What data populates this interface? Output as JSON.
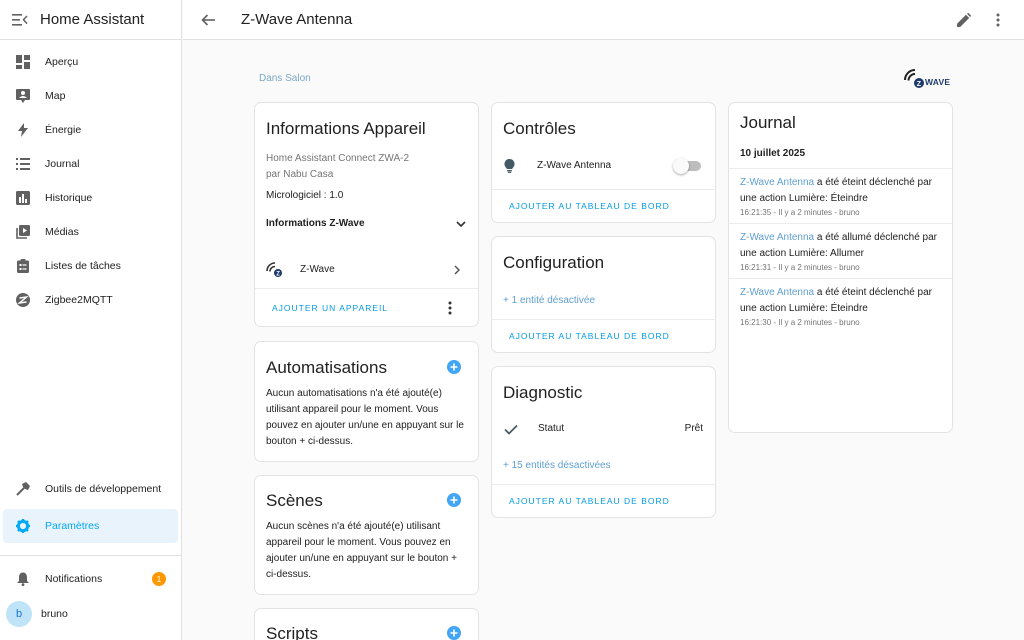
{
  "sidebar": {
    "title": "Home Assistant",
    "items": [
      {
        "label": "Aperçu",
        "icon": "dashboard-icon"
      },
      {
        "label": "Map",
        "icon": "map-icon"
      },
      {
        "label": "Énergie",
        "icon": "lightning-icon"
      },
      {
        "label": "Journal",
        "icon": "list-icon"
      },
      {
        "label": "Historique",
        "icon": "chart-bar-icon"
      },
      {
        "label": "Médias",
        "icon": "play-box-icon"
      },
      {
        "label": "Listes de tâches",
        "icon": "clipboard-list-icon"
      },
      {
        "label": "Zigbee2MQTT",
        "icon": "zigbee-icon"
      }
    ],
    "dev_tools": "Outils de développement",
    "settings": "Paramètres",
    "notifications": "Notifications",
    "notifications_count": "1",
    "user_initial": "b",
    "user_name": "bruno"
  },
  "header": {
    "title": "Z-Wave Antenna"
  },
  "area_link": "Dans Salon",
  "logo_text": "WAVE",
  "device_info": {
    "title": "Informations Appareil",
    "model": "Home Assistant Connect ZWA-2",
    "manufacturer": "par Nabu Casa",
    "firmware": "Micrologiciel : 1.0",
    "zwave_info": "Informations Z-Wave",
    "integration": "Z-Wave",
    "add_device": "AJOUTER UN APPAREIL"
  },
  "automations": {
    "title": "Automatisations",
    "text": "Aucun automatisations n'a été ajouté(e) utilisant appareil pour le moment. Vous pouvez en ajouter un/une en appuyant sur le bouton + ci-dessus."
  },
  "scenes": {
    "title": "Scènes",
    "text": "Aucun scènes n'a été ajouté(e) utilisant appareil pour le moment. Vous pouvez en ajouter un/une en appuyant sur le bouton + ci-dessus."
  },
  "scripts": {
    "title": "Scripts"
  },
  "controls": {
    "title": "Contrôles",
    "entity": "Z-Wave Antenna",
    "add_dashboard": "AJOUTER AU TABLEAU DE BORD"
  },
  "configuration": {
    "title": "Configuration",
    "disabled": "+ 1 entité désactivée",
    "add_dashboard": "AJOUTER AU TABLEAU DE BORD"
  },
  "diagnostic": {
    "title": "Diagnostic",
    "status_label": "Statut",
    "status_value": "Prêt",
    "disabled": "+ 15 entités désactivées",
    "add_dashboard": "AJOUTER AU TABLEAU DE BORD"
  },
  "journal": {
    "title": "Journal",
    "date": "10 juillet 2025",
    "entries": [
      {
        "entity": "Z-Wave Antenna",
        "text": " a été éteint déclenché par une action Lumière: Éteindre",
        "meta": "16:21:35 - Il y a 2 minutes - bruno"
      },
      {
        "entity": "Z-Wave Antenna",
        "text": " a été allumé déclenché par une action Lumière: Allumer",
        "meta": "16:21:31 - Il y a 2 minutes - bruno"
      },
      {
        "entity": "Z-Wave Antenna",
        "text": " a été éteint déclenché par une action Lumière: Éteindre",
        "meta": "16:21:30 - Il y a 2 minutes - bruno"
      }
    ]
  }
}
